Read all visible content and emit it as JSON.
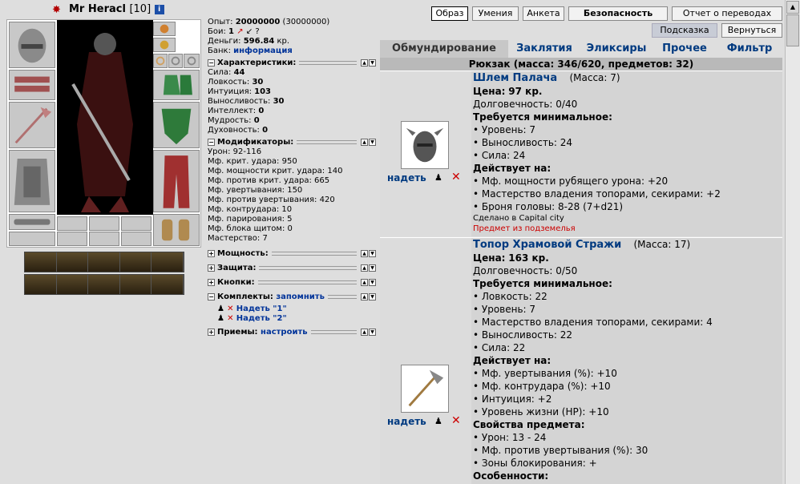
{
  "header": {
    "name": "Mr Heracl",
    "level": "[10]",
    "info_badge": "i"
  },
  "stats_top": {
    "exp_label": "Опыт:",
    "exp": "20000000",
    "exp_next": "(30000000)",
    "battles_label": "Бои:",
    "battles_won": "1",
    "battles_sep": "?",
    "money_label": "Деньги:",
    "money": "596.84",
    "money_unit": "кр.",
    "bank_label": "Банк:",
    "bank_link": "информация"
  },
  "characteristics": {
    "title": "Характеристики:",
    "items": [
      {
        "label": "Сила:",
        "value": "44"
      },
      {
        "label": "Ловкость:",
        "value": "30"
      },
      {
        "label": "Интуиция:",
        "value": "103"
      },
      {
        "label": "Выносливость:",
        "value": "30"
      },
      {
        "label": "Интеллект:",
        "value": "0"
      },
      {
        "label": "Мудрость:",
        "value": "0"
      },
      {
        "label": "Духовность:",
        "value": "0"
      }
    ]
  },
  "modifiers": {
    "title": "Модификаторы:",
    "items": [
      {
        "label": "Урон:",
        "value": "92-116"
      },
      {
        "label": "Мф. крит. удара:",
        "value": "950"
      },
      {
        "label": "Мф. мощности крит. удара:",
        "value": "140"
      },
      {
        "label": "Мф. против крит. удара:",
        "value": "665"
      },
      {
        "label": "Мф. увертывания:",
        "value": "150"
      },
      {
        "label": "Мф. против увертывания:",
        "value": "420"
      },
      {
        "label": "Мф. контрудара:",
        "value": "10"
      },
      {
        "label": "Мф. парирования:",
        "value": "5"
      },
      {
        "label": "Мф. блока щитом:",
        "value": "0"
      },
      {
        "label": "Мастерство:",
        "value": "7"
      }
    ]
  },
  "sections": {
    "power": "Мощность:",
    "defense": "Защита:",
    "buttons": "Кнопки:",
    "sets": "Комплекты:",
    "sets_link": "запомнить",
    "set1": "Надеть \"1\"",
    "set2": "Надеть \"2\"",
    "tricks": "Приемы:",
    "tricks_link": "настроить"
  },
  "top_buttons": {
    "image": "Образ",
    "skills": "Умения",
    "profile": "Анкета",
    "security": "Безопасность",
    "transfers": "Отчет о переводах",
    "hint": "Подсказка",
    "back": "Вернуться"
  },
  "tabs": [
    "Обмундирование",
    "Заклятия",
    "Эликсиры",
    "Прочее",
    "Фильтр"
  ],
  "backpack": "Рюкзак (масса: 346/620, предметов: 32)",
  "items": [
    {
      "wear": "надеть",
      "name": "Шлем Палача",
      "mass": "(Масса: 7)",
      "price_label": "Цена:",
      "price": "97 кр.",
      "durability": "Долговечность: 0/40",
      "req_title": "Требуется минимальное:",
      "reqs": [
        "• Уровень: 7",
        "• Выносливость: 24",
        "• Сила: 24"
      ],
      "acts_title": "Действует на:",
      "acts": [
        "• Мф. мощности рубящего урона: +20",
        "• Мастерство владения топорами, секирами: +2",
        "• Броня головы: 8-28 (7+d21)"
      ],
      "made": "Сделано в Capital city",
      "origin": "Предмет из подземелья"
    },
    {
      "wear": "надеть",
      "name": "Топор Храмовой Стражи",
      "mass": "(Масса: 17)",
      "price_label": "Цена:",
      "price": "163 кр.",
      "durability": "Долговечность: 0/50",
      "req_title": "Требуется минимальное:",
      "reqs": [
        "• Ловкость: 22",
        "• Уровень: 7",
        "• Мастерство владения топорами, секирами: 4",
        "• Выносливость: 22",
        "• Сила: 22"
      ],
      "acts_title": "Действует на:",
      "acts": [
        "• Мф. увертывания (%): +10",
        "• Мф. контрудара (%): +10",
        "• Интуиция: +2",
        "• Уровень жизни (HP): +10"
      ],
      "props_title": "Свойства предмета:",
      "props": [
        "• Урон: 13 - 24",
        "• Мф. против увертывания (%): 30",
        "• Зоны блокирования: +"
      ],
      "features_title": "Особенности:"
    }
  ]
}
